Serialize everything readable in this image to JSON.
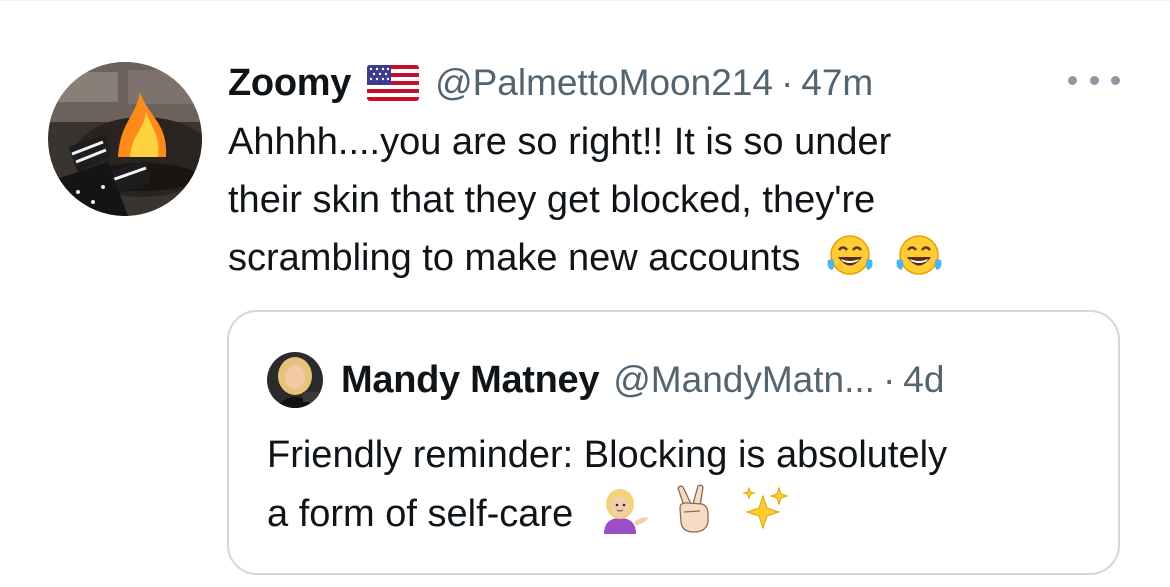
{
  "tweet": {
    "display_name": "Zoomy",
    "flag_icon": "us-flag-icon",
    "handle": "@PalmettoMoon214",
    "separator": "·",
    "time": "47m",
    "text_lines": [
      "Ahhhh....you are so right!! It is so under",
      "their skin that they get blocked, they're",
      "scrambling to make new accounts"
    ],
    "emojis": [
      "face-with-tears-of-joy-icon",
      "face-with-tears-of-joy-icon"
    ],
    "more_icon": "more-options-icon"
  },
  "quote": {
    "display_name": "Mandy Matney",
    "handle": "@MandyMatn...",
    "separator": "·",
    "time": "4d",
    "text_lines": [
      "Friendly reminder: Blocking is absolutely",
      "a form of self-care"
    ],
    "emojis": [
      "person-tipping-hand-icon",
      "victory-hand-icon",
      "sparkles-icon"
    ]
  },
  "colors": {
    "text": "#0f1419",
    "secondary": "#536471",
    "border": "#cfd9de"
  }
}
